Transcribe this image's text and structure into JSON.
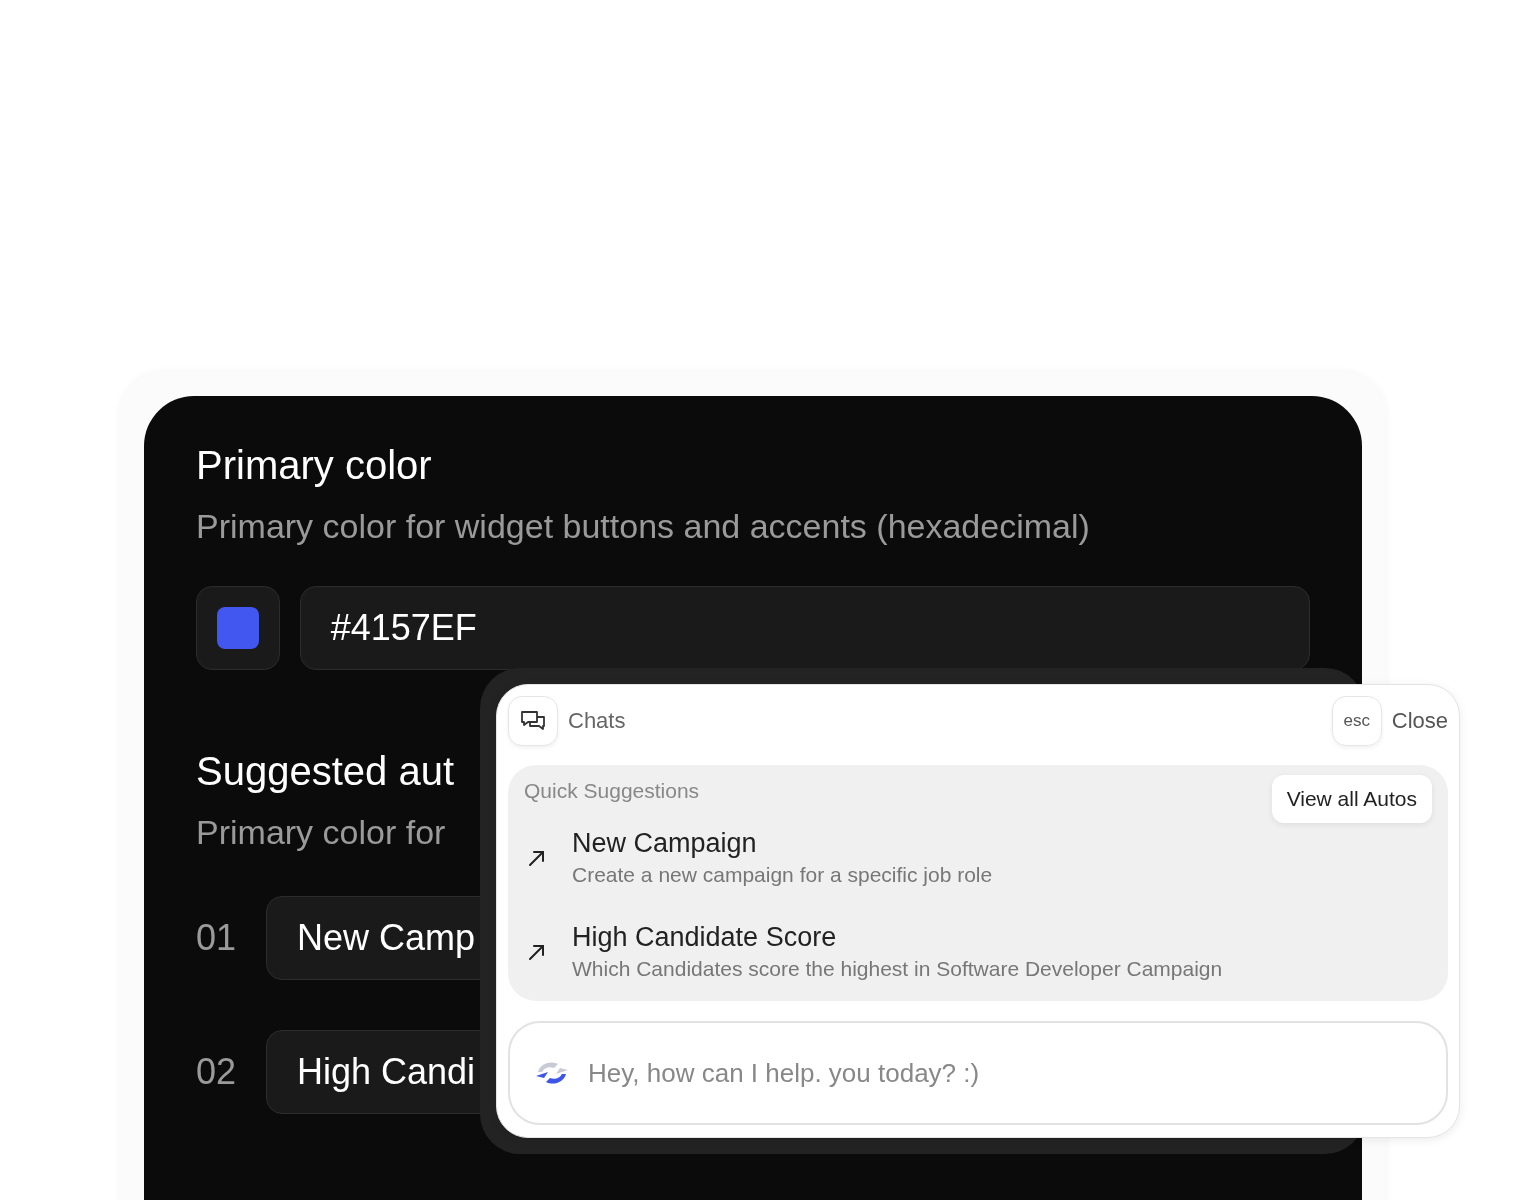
{
  "primary_color": {
    "title": "Primary color",
    "description": "Primary color for widget buttons and accents (hexadecimal)",
    "value": "#4157EF"
  },
  "suggested_autos": {
    "title": "Suggested aut",
    "description": "Primary color for",
    "items": [
      {
        "number": "01",
        "label": "New Camp"
      },
      {
        "number": "02",
        "label": "High Candi"
      }
    ]
  },
  "chat_panel": {
    "tab": "Chats",
    "esc_key": "esc",
    "close": "Close",
    "section_title": "Quick Suggestions",
    "view_all": "View all Autos",
    "suggestions": [
      {
        "title": "New Campaign",
        "description": "Create a new campaign for a specific job role"
      },
      {
        "title": "High Candidate Score",
        "description": "Which Candidates score the highest in Software Developer Campaign"
      }
    ],
    "input": {
      "placeholder": "Hey, how can I help. you today? :)"
    }
  }
}
